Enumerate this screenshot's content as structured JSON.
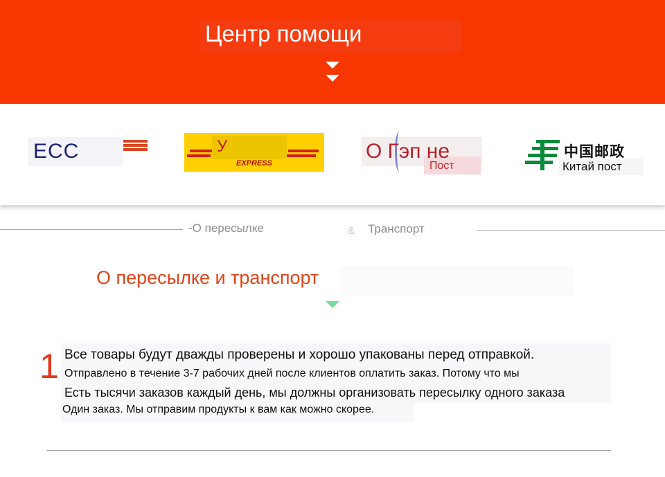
{
  "header": {
    "title": "Центр помощи",
    "background_color": "#f83700"
  },
  "carriers": {
    "ems": {
      "label": "ECC"
    },
    "ups": {
      "label": "У",
      "sub_label": "EXPRESS"
    },
    "post": {
      "label": "О Гэп не",
      "sub_label": "Пост"
    },
    "china_post": {
      "chinese_label": "中国邮政",
      "label": "Китай пост"
    }
  },
  "subnav": {
    "left_label": "-О пересылке",
    "ampersand": "&",
    "right_label": "Транспорт"
  },
  "section": {
    "title": "О пересылке и транспорт",
    "number": "1",
    "lines": [
      "Все товары будут дважды проверены и хорошо упакованы перед отправкой.",
      "Отправлено в течение 3-7 рабочих дней после клиентов оплатить заказ. Потому что мы",
      "Есть тысячи заказов каждый день, мы должны организовать пересылку одного заказа",
      "Один заказ. Мы отправим продукты к вам как можно скорее."
    ]
  },
  "colors": {
    "accent": "#e2431a",
    "ems_blue": "#1c1f6f",
    "ups_yellow": "#ffcf00",
    "post_red": "#b7222a",
    "china_post_green": "#0a8a3a",
    "chevron_green": "#77dd9e"
  }
}
